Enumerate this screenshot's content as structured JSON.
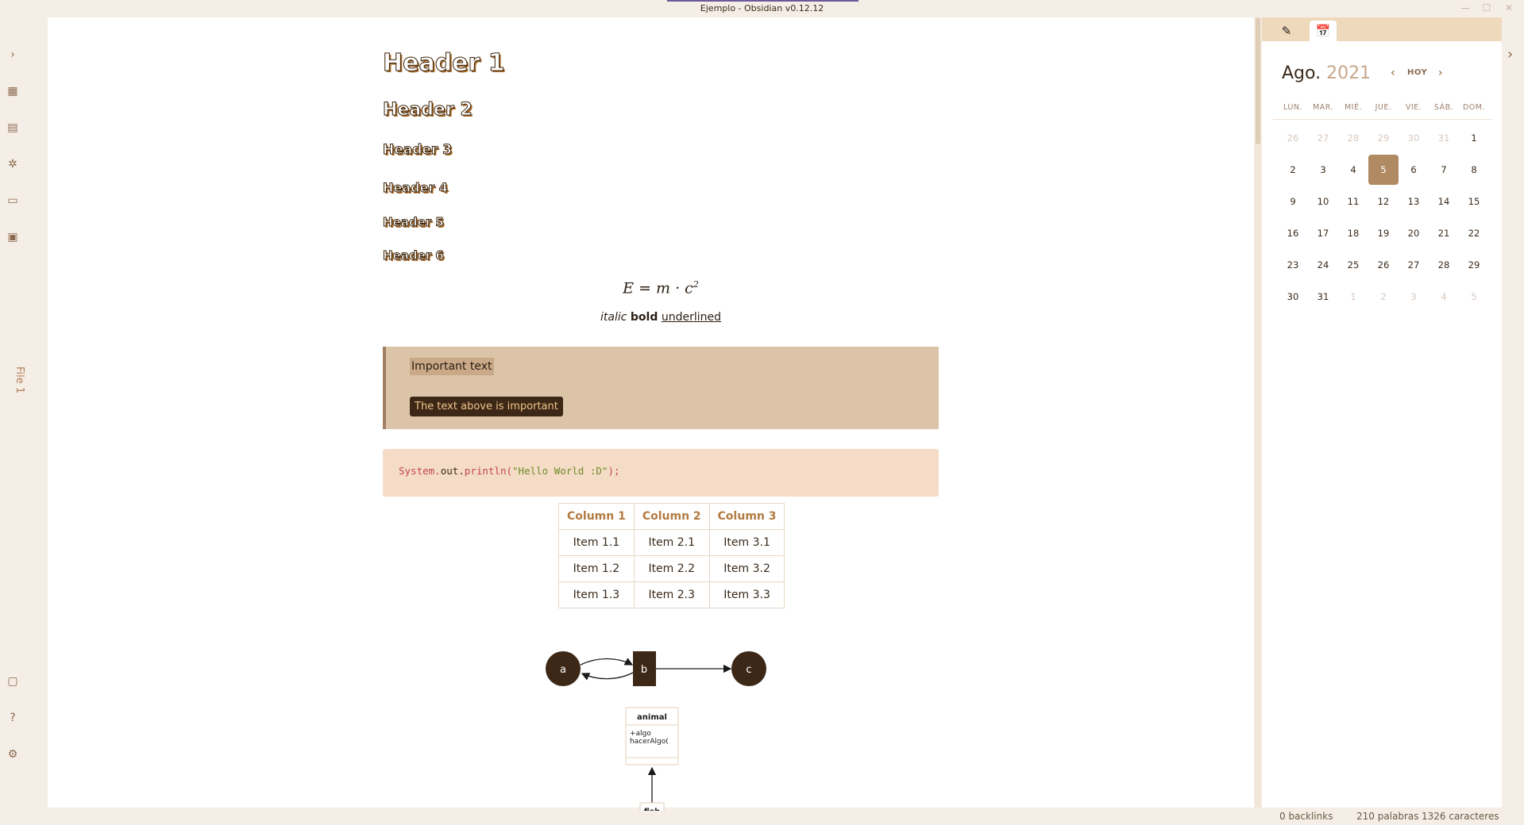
{
  "window": {
    "title": "Ejemplo - Obsidian v0.12.12",
    "min_glyph": "—",
    "max_glyph": "☐",
    "close_glyph": "✕"
  },
  "ribbon": {
    "items": [
      {
        "icon": "chevron-right-icon",
        "glyph": "›"
      },
      {
        "icon": "table-icon",
        "glyph": "▦"
      },
      {
        "icon": "document-icon",
        "glyph": "▤"
      },
      {
        "icon": "graph-icon",
        "glyph": "✲"
      },
      {
        "icon": "cards-icon",
        "glyph": "▭"
      },
      {
        "icon": "plugins-icon",
        "glyph": "▣"
      },
      {
        "icon": "vault-icon",
        "glyph": "▢"
      },
      {
        "icon": "help-icon",
        "glyph": "?"
      },
      {
        "icon": "settings-icon",
        "glyph": "⚙"
      }
    ]
  },
  "file_tab": {
    "label": "File 1"
  },
  "note": {
    "headers": [
      "Header 1",
      "Header 2",
      "Header 3",
      "Header 4",
      "Header 5",
      "Header 6"
    ],
    "math_lhs": "E = m · c",
    "math_exp": "2",
    "italic": "italic",
    "bold": "bold",
    "underlined": "underlined",
    "callout_title": "Important text",
    "callout_body": "The text above is important",
    "code_part1": "System.",
    "code_part2": "out.",
    "code_part3": "println(",
    "code_string": "\"Hello World :D\"",
    "code_end": ");",
    "table": {
      "headers": [
        "Column 1",
        "Column 2",
        "Column 3"
      ],
      "rows": [
        [
          "Item 1.1",
          "Item 2.1",
          "Item 3.1"
        ],
        [
          "Item 1.2",
          "Item 2.2",
          "Item 3.2"
        ],
        [
          "Item 1.3",
          "Item 2.3",
          "Item 3.3"
        ]
      ]
    },
    "flow_nodes": [
      "a",
      "b",
      "c"
    ],
    "uml": {
      "class_name": "animal",
      "member1": "+algo",
      "member2": "hacerAlgo(",
      "child": "fish"
    }
  },
  "right_panel": {
    "tabs": [
      {
        "icon": "pen-icon",
        "glyph": "✎"
      },
      {
        "icon": "calendar-icon",
        "glyph": "📅"
      }
    ],
    "calendar": {
      "month": "Ago.",
      "year": "2021",
      "today_label": "HOY",
      "prev_glyph": "‹",
      "next_glyph": "›",
      "weekdays": [
        "LUN.",
        "MAR.",
        "MIÉ.",
        "JUE.",
        "VIE.",
        "SÁB.",
        "DOM."
      ],
      "weeks": [
        [
          "26",
          "27",
          "28",
          "29",
          "30",
          "31",
          "1"
        ],
        [
          "2",
          "3",
          "4",
          "5",
          "6",
          "7",
          "8"
        ],
        [
          "9",
          "10",
          "11",
          "12",
          "13",
          "14",
          "15"
        ],
        [
          "16",
          "17",
          "18",
          "19",
          "20",
          "21",
          "22"
        ],
        [
          "23",
          "24",
          "25",
          "26",
          "27",
          "28",
          "29"
        ],
        [
          "30",
          "31",
          "1",
          "2",
          "3",
          "4",
          "5"
        ]
      ],
      "selected_day": "5"
    }
  },
  "right_collapse_glyph": "›",
  "status": {
    "backlinks": "0 backlinks",
    "words": "210 palabras",
    "chars": "1326 caracteres"
  },
  "colors": {
    "background": "#f5eee6",
    "accent": "#b08a62",
    "callout": "#dcc4a8",
    "code_bg": "#f5dcc6",
    "dark_node": "#3d2817"
  }
}
